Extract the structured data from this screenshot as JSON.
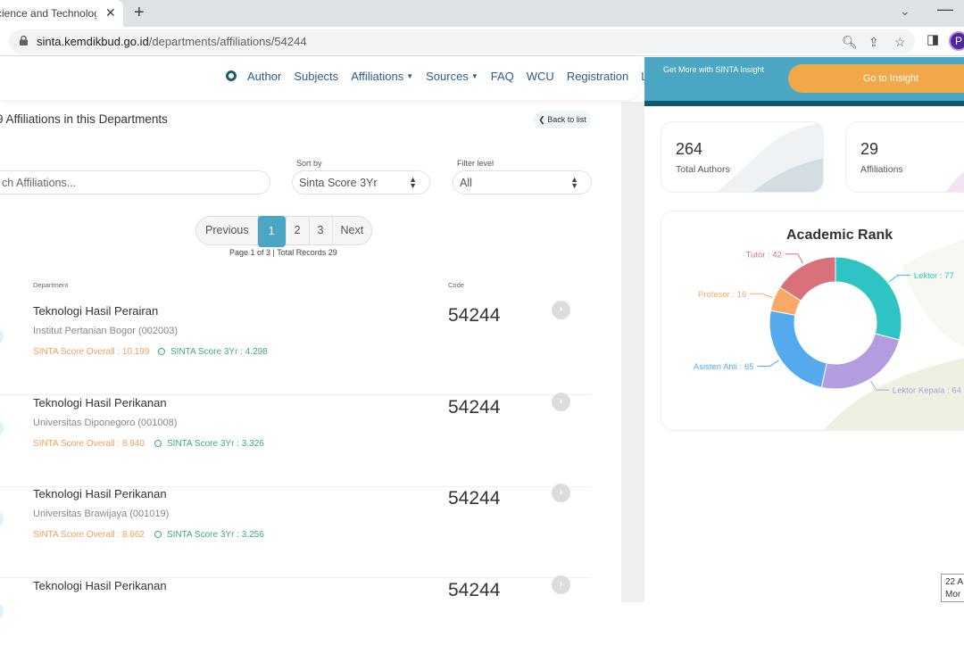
{
  "browser": {
    "tab_title": "cience and Technology",
    "url_host": "sinta.kemdikbud.go.id",
    "url_path": "/departments/affiliations/54244",
    "avatar_letter": "P"
  },
  "nav": {
    "items": [
      "Author",
      "Subjects",
      "Affiliations",
      "Sources",
      "FAQ",
      "WCU",
      "Registration",
      "Login"
    ]
  },
  "main": {
    "heading": "9 Affiliations in this Departments",
    "back_label": "Back to list",
    "search_placeholder": "ch Affiliations...",
    "sort_label": "Sort by",
    "sort_value": "Sinta Score 3Yr",
    "filter_label": "Filter level",
    "filter_value": "All",
    "pagination": {
      "previous": "Previous",
      "pages": [
        "1",
        "2",
        "3"
      ],
      "current": "1",
      "next": "Next",
      "info": "Page 1 of 3 | Total Records 29"
    },
    "columns": {
      "department": "Department",
      "code": "Code"
    },
    "rows": [
      {
        "name": "Teknologi Hasil Perairan",
        "institution": "Institut Pertanian Bogor (002003)",
        "score_overall": "SINTA Score Overall : 10.199",
        "score_3yr": "SINTA Score 3Yr : 4.298",
        "code": "54244"
      },
      {
        "name": "Teknologi Hasil Perikanan",
        "institution": "Universitas Diponegoro (001008)",
        "score_overall": "SINTA Score Overall : 8.940",
        "score_3yr": "SINTA Score 3Yr : 3.326",
        "code": "54244"
      },
      {
        "name": "Teknologi Hasil Perikanan",
        "institution": "Universitas Brawijaya (001019)",
        "score_overall": "SINTA Score Overall : 8.662",
        "score_3yr": "SINTA Score 3Yr : 3.256",
        "code": "54244"
      },
      {
        "name": "Teknologi Hasil Perikanan",
        "institution": "",
        "score_overall": "",
        "score_3yr": "",
        "code": "54244"
      }
    ]
  },
  "side": {
    "insight_text": "Get More with SINTA Insight",
    "insight_button": "Go to Insight",
    "stats": [
      {
        "value": "264",
        "label": "Total Authors"
      },
      {
        "value": "29",
        "label": "Affiliations"
      }
    ]
  },
  "chart_data": {
    "type": "pie",
    "title": "Academic Rank",
    "donut": true,
    "slices": [
      {
        "label": "Lektor",
        "value": 77,
        "color": "#2ec4c4"
      },
      {
        "label": "Lektor Kepala",
        "value": 64,
        "color": "#b39ddf"
      },
      {
        "label": "Asisten Ahli",
        "value": 65,
        "color": "#55aaee"
      },
      {
        "label": "Profesor",
        "value": 16,
        "color": "#f9a866"
      },
      {
        "label": "Tutor",
        "value": 42,
        "color": "#d9717a"
      }
    ]
  },
  "tooltip": {
    "line1": "22 A",
    "line2": "Mor"
  }
}
